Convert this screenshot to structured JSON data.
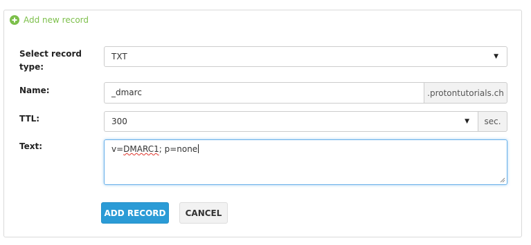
{
  "header": {
    "add_label": "Add new record",
    "icon": "plus-circle-icon",
    "accent": "#7cbf4a"
  },
  "form": {
    "record_type": {
      "label": "Select record type:",
      "value": "TXT"
    },
    "name": {
      "label": "Name:",
      "value": "_dmarc",
      "suffix": ".protontutorials.ch"
    },
    "ttl": {
      "label": "TTL:",
      "value": "300",
      "unit": "sec."
    },
    "text": {
      "label": "Text:",
      "value_misspelled": "DMARC1",
      "value_prefix": "v=",
      "value_suffix": "; p=none"
    }
  },
  "buttons": {
    "add_label": "ADD RECORD",
    "cancel_label": "CANCEL",
    "primary_color": "#2b9bd6"
  }
}
